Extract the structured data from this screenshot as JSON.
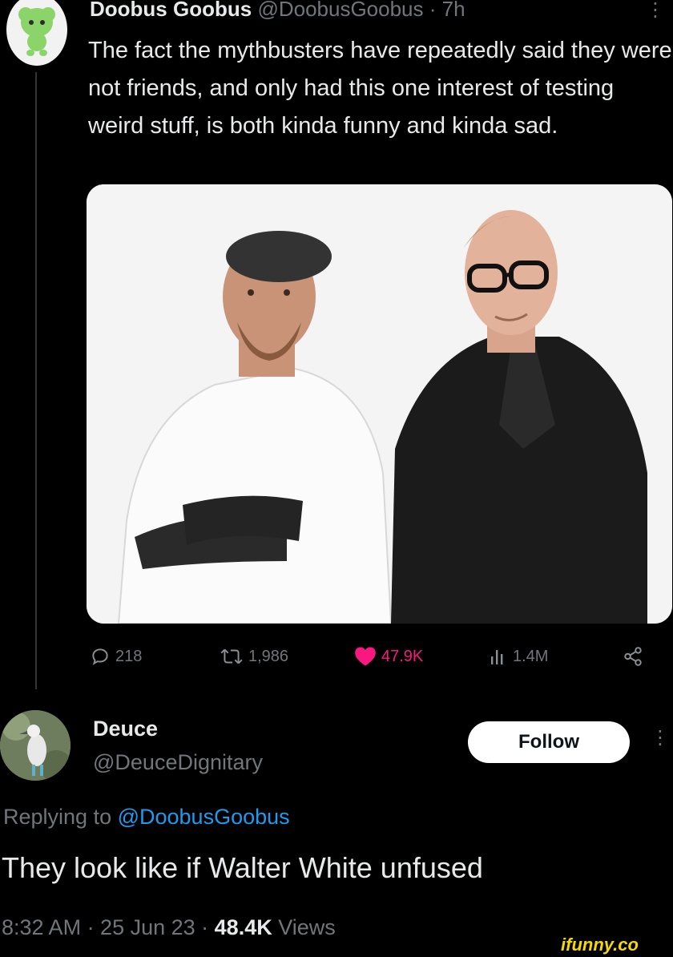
{
  "tweet": {
    "author_name": "Doobus Goobus",
    "author_handle": "@DoobusGoobus",
    "time": " · 7h",
    "text": "The fact the mythbusters have repeatedly said they were not friends, and only had this one interest of testing weird stuff, is both kinda funny and kinda sad.",
    "more_icon": "more-vertical-icon",
    "stats": {
      "replies": "218",
      "retweets": "1,986",
      "likes": "47.9K",
      "views": "1.4M"
    },
    "colors": {
      "like": "#f91880",
      "muted": "#71767b"
    }
  },
  "reply": {
    "author_name": "Deuce",
    "author_handle": "@DeuceDignitary",
    "follow_label": "Follow",
    "replying_prefix": "Replying to ",
    "replying_mention": "@DoobusGoobus",
    "text": "They look like if Walter White unfused",
    "meta_time": "8:32 AM · 25 Jun 23 · ",
    "meta_views_count": "48.4K",
    "meta_views_label": " Views",
    "colors": {
      "mention": "#1d9bf0"
    }
  },
  "watermark": "ifunny.co"
}
